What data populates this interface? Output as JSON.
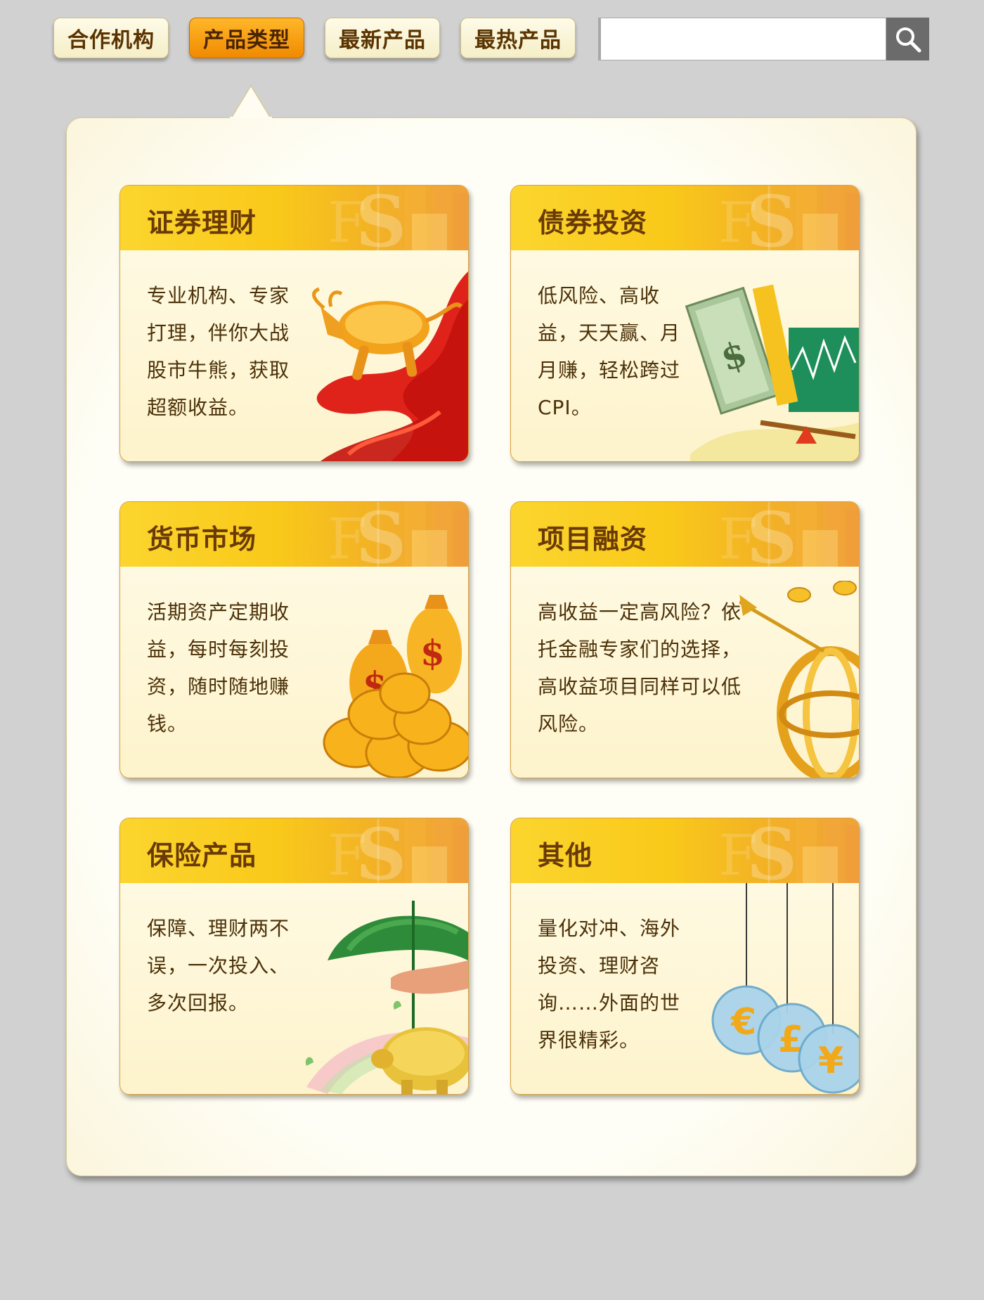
{
  "nav": {
    "tabs": [
      {
        "label": "合作机构",
        "active": false
      },
      {
        "label": "产品类型",
        "active": true
      },
      {
        "label": "最新产品",
        "active": false
      },
      {
        "label": "最热产品",
        "active": false
      }
    ]
  },
  "search": {
    "value": "",
    "placeholder": "",
    "icon": "search-icon"
  },
  "colors": {
    "active_tab": "#f7a01a",
    "tab": "#f7f1d0",
    "card_header": "#fad126",
    "title_text": "#6a3a06",
    "page_bg": "#d1d1d1"
  },
  "cards": [
    {
      "title": "证券理财",
      "description": "专业机构、专家打理，伴你大战股市牛熊，获取超额收益。",
      "art": "golden-bull-icon"
    },
    {
      "title": "债券投资",
      "description": "低风险、高收益，天天赢、月月赚，轻松跨过CPI。",
      "art": "money-chart-icon"
    },
    {
      "title": "货币市场",
      "description": "活期资产定期收益，每时每刻投资，随时随地赚钱。",
      "art": "money-bags-icon"
    },
    {
      "title": "项目融资",
      "description": "高收益一定高风险？依托金融专家们的选择，高收益项目同样可以低风险。",
      "art": "golden-globe-icon"
    },
    {
      "title": "保险产品",
      "description": "保障、理财两不误，一次投入、多次回报。",
      "art": "umbrella-piggybank-icon"
    },
    {
      "title": "其他",
      "description": "量化对冲、海外投资、理财咨询……外面的世界很精彩。",
      "art": "currency-bubbles-icon"
    }
  ]
}
